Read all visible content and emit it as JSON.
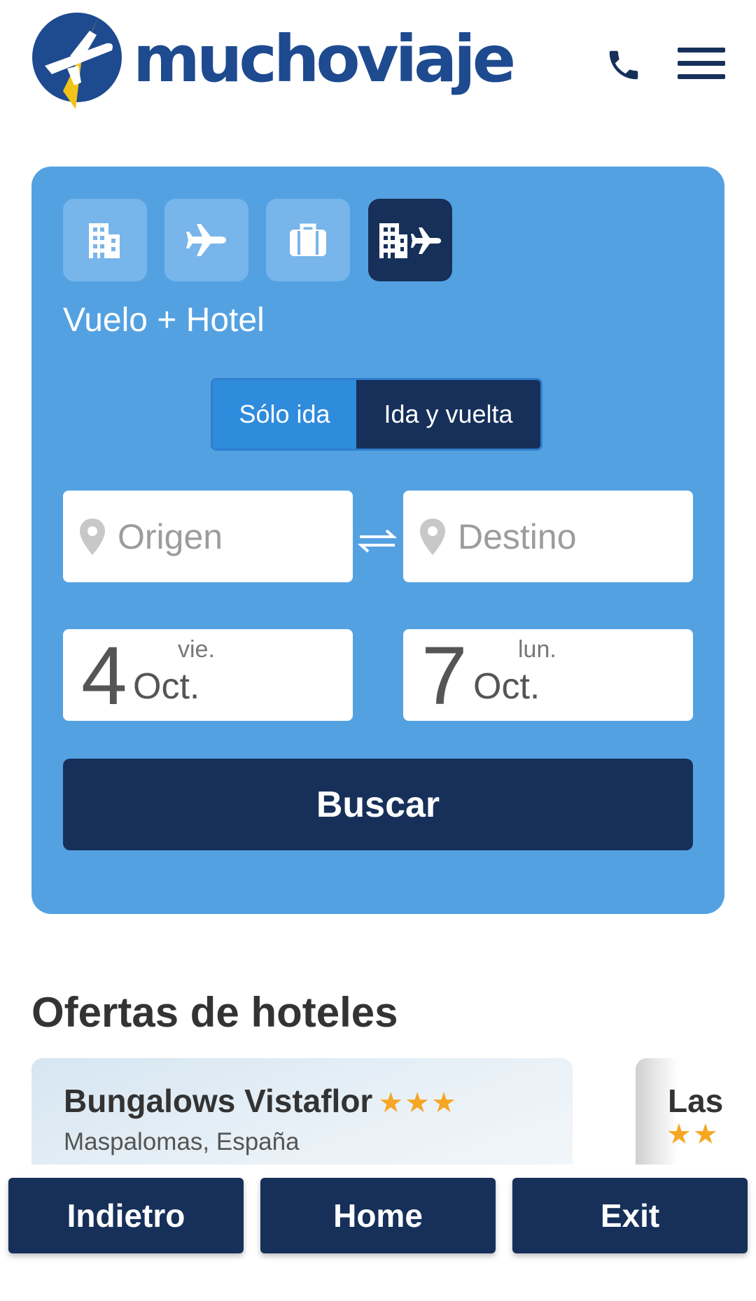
{
  "header": {
    "brand": "muchoviaje",
    "phone_icon": "phone-icon",
    "menu_icon": "hamburger-menu-icon"
  },
  "search": {
    "product_tabs": [
      {
        "icon": "hotel-icon",
        "active": false
      },
      {
        "icon": "plane-icon",
        "active": false
      },
      {
        "icon": "suitcase-icon",
        "active": false
      },
      {
        "icon": "hotel-plus-plane-icon",
        "active": true
      }
    ],
    "product_title": "Vuelo + Hotel",
    "trip_type": {
      "one_way": "Sólo ida",
      "round_trip": "Ida y vuelta",
      "selected": "Ida y vuelta"
    },
    "origin_placeholder": "Origen",
    "destination_placeholder": "Destino",
    "depart": {
      "day": "4",
      "weekday": "vie.",
      "month": "Oct."
    },
    "return": {
      "day": "7",
      "weekday": "lun.",
      "month": "Oct."
    },
    "search_label": "Buscar"
  },
  "offers": {
    "title": "Ofertas de hoteles",
    "items": [
      {
        "name": "Bungalows Vistaflor",
        "stars": "★★★",
        "location": "Maspalomas, España"
      },
      {
        "name": "Las",
        "stars": "★★",
        "location": ""
      }
    ]
  },
  "bottom_nav": {
    "back": "Indietro",
    "home": "Home",
    "exit": "Exit"
  },
  "colors": {
    "brand_blue": "#1e4a8f",
    "dark_navy": "#16305a",
    "card_blue": "#54a1e2",
    "star": "#f5a623"
  }
}
